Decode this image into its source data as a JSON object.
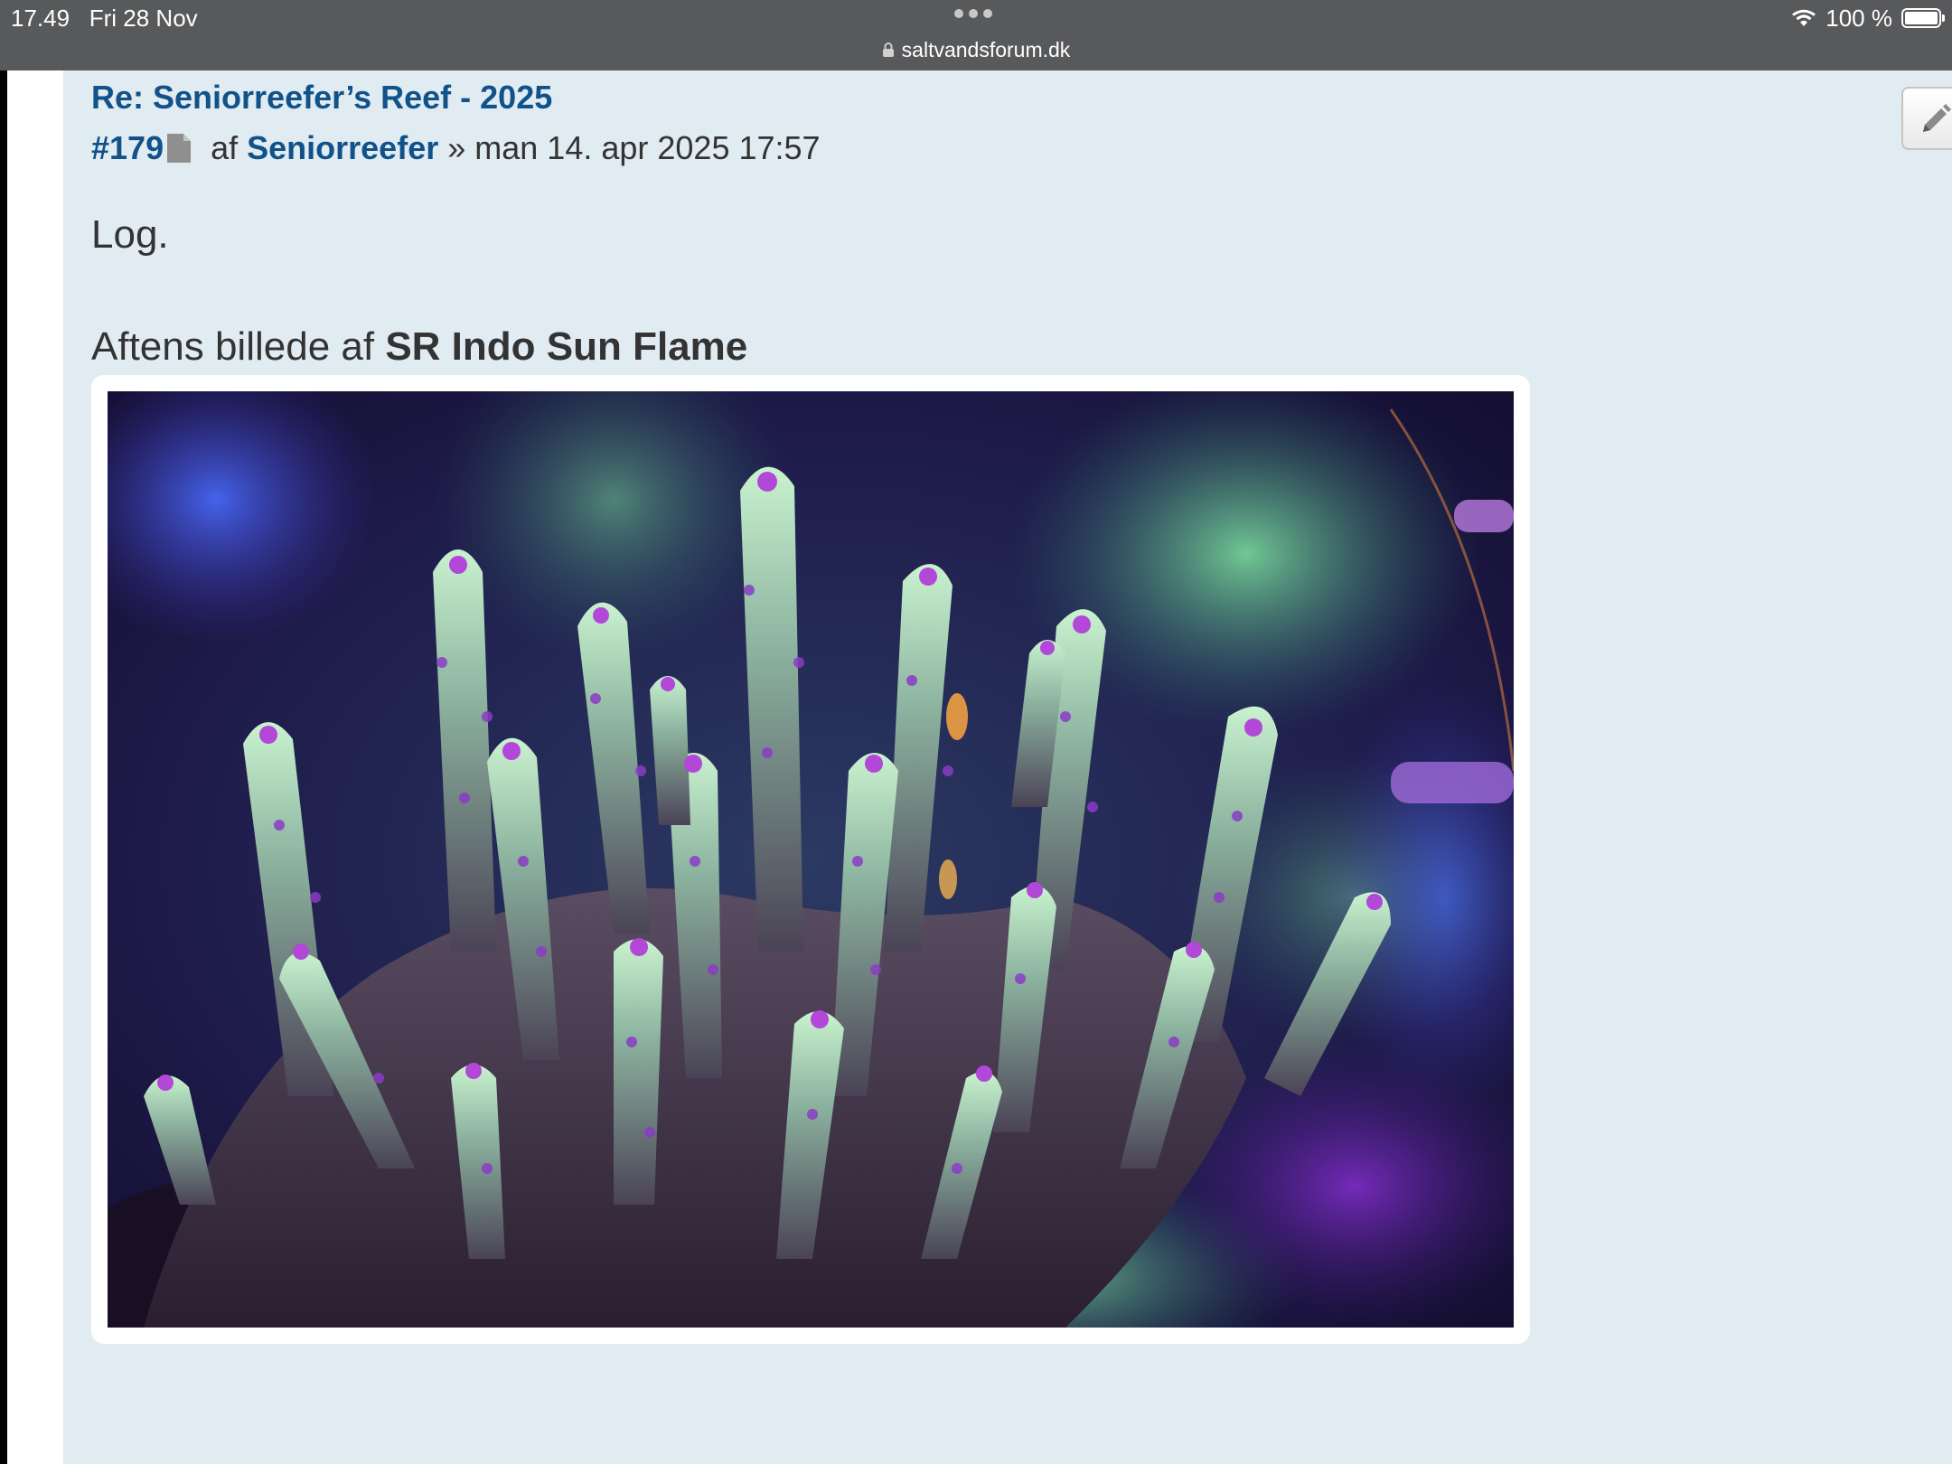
{
  "status": {
    "time_date": "17.49   Fri 28 Nov",
    "battery": "100 %"
  },
  "browser": {
    "url": "saltvandsforum.dk"
  },
  "post": {
    "title": "Re: Seniorreefer’s Reef - 2025",
    "number": "#179",
    "by": "af ",
    "author": "Seniorreefer",
    "date": " » man 14. apr 2025 17:57",
    "line1": "Log.",
    "line2_prefix": "Aftens billede af ",
    "line2_bold": "SR Indo Sun Flame"
  },
  "icons": {
    "lock": "lock-icon",
    "document": "document-icon",
    "edit": "pencil-icon",
    "wifi": "wifi-icon",
    "battery": "battery-icon"
  },
  "colors": {
    "link": "#105289",
    "post_bg": "#e1ebf2",
    "status_bar": "#58595b"
  }
}
